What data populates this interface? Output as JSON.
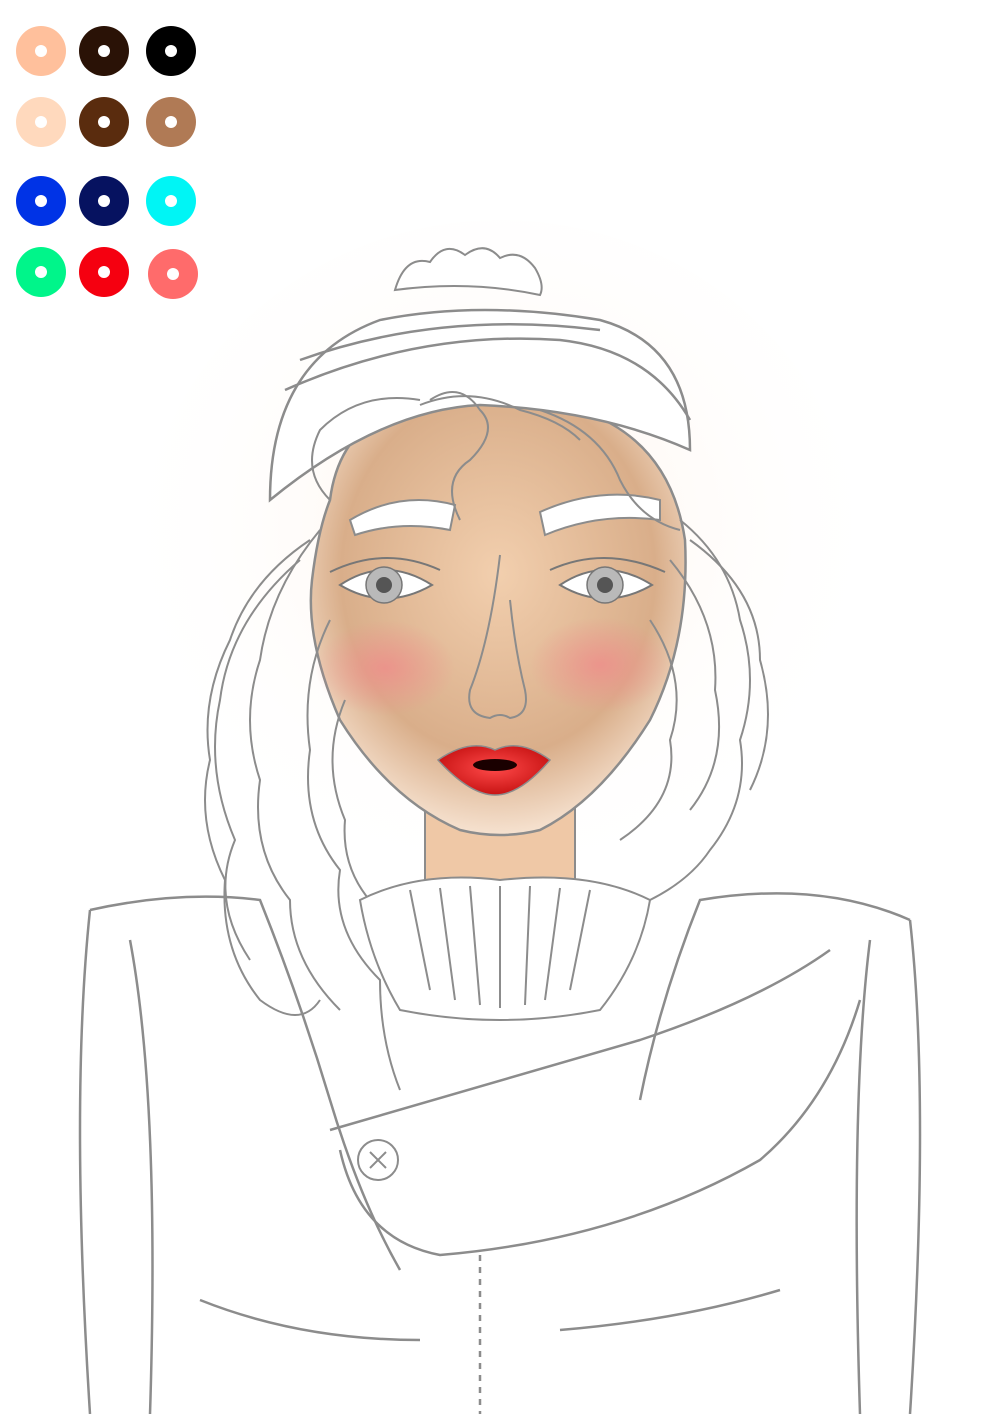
{
  "palette": {
    "swatches": [
      {
        "name": "swatch-peach",
        "color": "#FFC09C"
      },
      {
        "name": "swatch-dark-brown",
        "color": "#2A1206"
      },
      {
        "name": "swatch-black",
        "color": "#000000"
      },
      {
        "name": "swatch-light-peach",
        "color": "#FFD9BD"
      },
      {
        "name": "swatch-brown",
        "color": "#5A2C0E"
      },
      {
        "name": "swatch-tan",
        "color": "#B07A55"
      },
      {
        "name": "swatch-blue",
        "color": "#0033E6"
      },
      {
        "name": "swatch-navy",
        "color": "#061260"
      },
      {
        "name": "swatch-cyan",
        "color": "#00F5F5"
      },
      {
        "name": "swatch-green",
        "color": "#00F58A"
      },
      {
        "name": "swatch-red",
        "color": "#F50010"
      },
      {
        "name": "swatch-coral",
        "color": "#FF6B6B"
      }
    ]
  },
  "artwork": {
    "line_color": "#8C8C8C",
    "skin_color": "#D9AE8A",
    "lip_color": "#E41C1C",
    "blush_color": "#F08A8A"
  }
}
